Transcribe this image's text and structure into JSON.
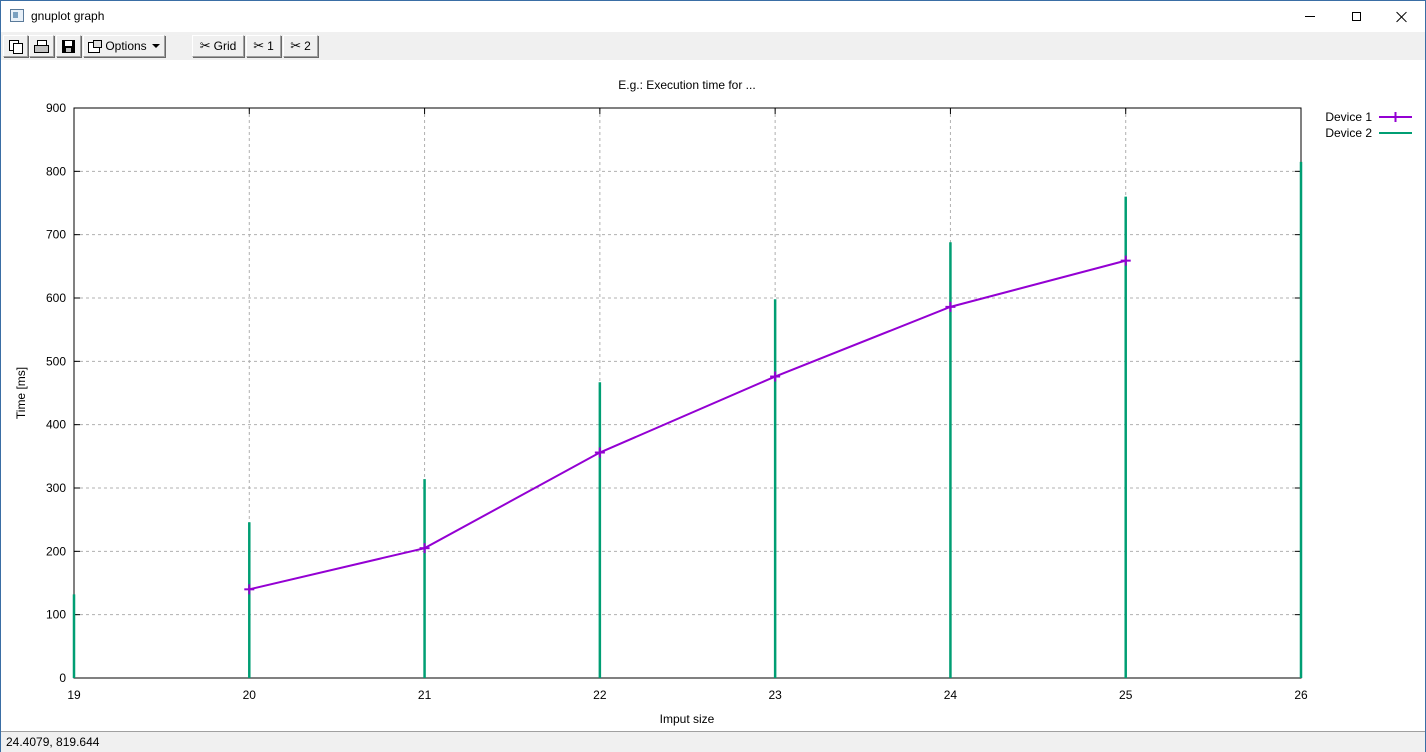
{
  "window": {
    "title": "gnuplot graph",
    "controls": {
      "minimize": "minimize",
      "maximize": "maximize",
      "close": "close"
    }
  },
  "toolbar": {
    "copy_icon": "copy-icon",
    "print_icon": "print-icon",
    "save_icon": "save-icon",
    "options_label": "Options",
    "grid_label": "Grid",
    "plot1_label": "1",
    "plot2_label": "2"
  },
  "statusbar": {
    "coordinates": "24.4079,  819.644"
  },
  "colors": {
    "device1": "#9400d3",
    "device2": "#009e73",
    "grid": "#b0b0b0"
  },
  "chart_data": {
    "type": "line",
    "title": "E.g.: Execution time for ...",
    "xlabel": "Imput size",
    "ylabel": "Time [ms]",
    "xlim": [
      19,
      26
    ],
    "ylim": [
      0,
      900
    ],
    "xticks": [
      19,
      20,
      21,
      22,
      23,
      24,
      25,
      26
    ],
    "yticks": [
      0,
      100,
      200,
      300,
      400,
      500,
      600,
      700,
      800,
      900
    ],
    "grid": true,
    "legend_position": "top-right",
    "series": [
      {
        "name": "Device 1",
        "style": "linespoints",
        "color": "#9400d3",
        "x": [
          20,
          21,
          22,
          23,
          24,
          25
        ],
        "y": [
          140,
          205,
          356,
          476,
          586,
          659
        ]
      },
      {
        "name": "Device 2",
        "style": "impulses",
        "color": "#009e73",
        "x": [
          19,
          20,
          21,
          22,
          23,
          24,
          25,
          26
        ],
        "y": [
          132,
          246,
          314,
          467,
          598,
          688,
          760,
          815
        ]
      }
    ]
  }
}
